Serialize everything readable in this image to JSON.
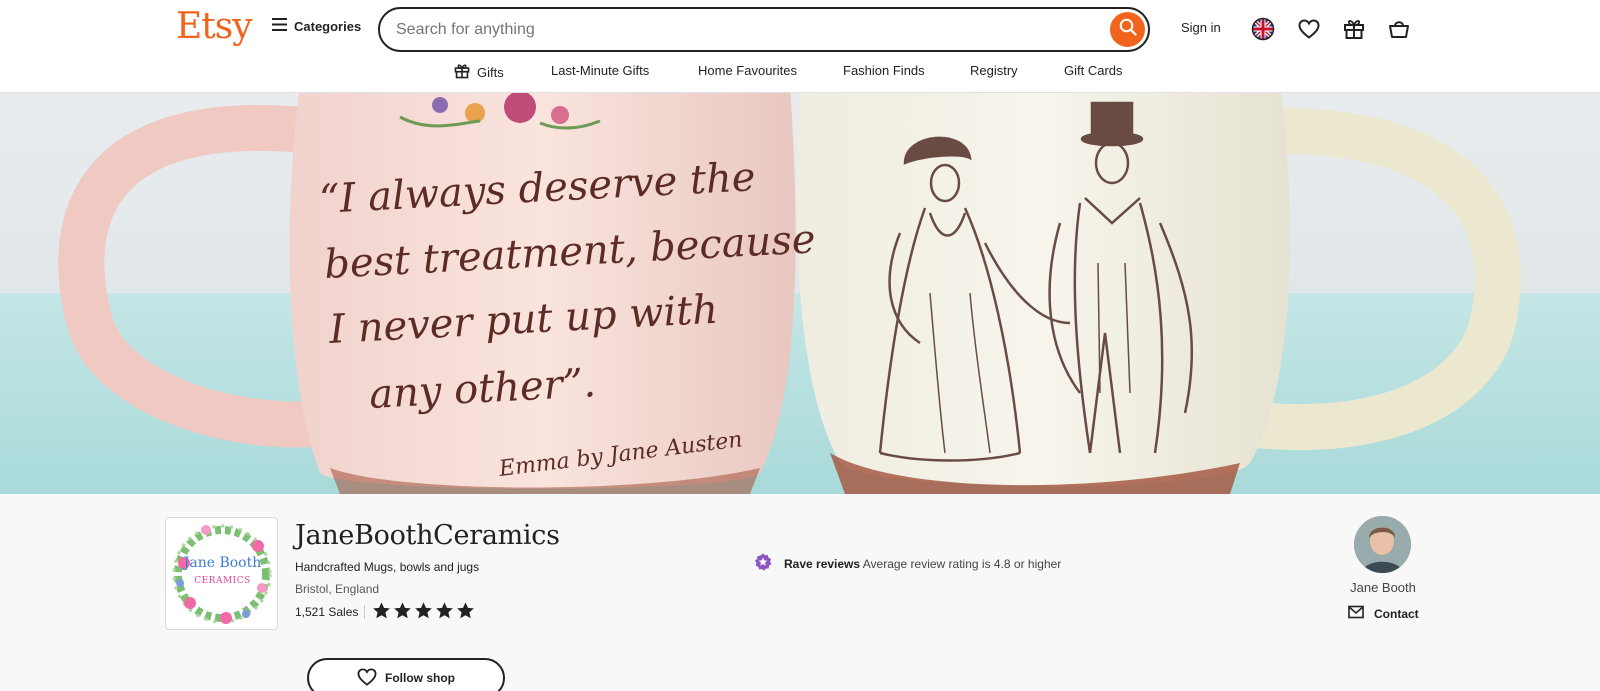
{
  "header": {
    "logo": "Etsy",
    "categories_label": "Categories",
    "search": {
      "placeholder": "Search for anything",
      "value": ""
    },
    "sign_in": "Sign in",
    "icons": [
      "menu-icon",
      "search-icon",
      "language-flag-icon",
      "heart-icon",
      "gift-icon",
      "cart-icon"
    ]
  },
  "subnav": {
    "items": [
      {
        "label": "Gifts",
        "icon": "gift-icon"
      },
      {
        "label": "Last-Minute Gifts"
      },
      {
        "label": "Home Favourites"
      },
      {
        "label": "Fashion Finds"
      },
      {
        "label": "Registry"
      },
      {
        "label": "Gift Cards"
      }
    ]
  },
  "banner": {
    "quote": "“I always deserve the best treatment, because I never put up with any other”.",
    "attribution": "Emma by Jane Austen"
  },
  "shop": {
    "logo_text": [
      "Jane Booth",
      "CERAMICS"
    ],
    "name": "JaneBoothCeramics",
    "tagline": "Handcrafted Mugs, bowls and jugs",
    "location": "Bristol, England",
    "sales": "1,521 Sales",
    "rating_stars": 5,
    "follow_label": "Follow shop",
    "rave_title": "Rave reviews",
    "rave_text": "Average review rating is 4.8 or higher",
    "owner_name": "Jane Booth",
    "contact_label": "Contact"
  },
  "colors": {
    "brand": "#f1641e",
    "rave_badge": "#8e56c2",
    "text": "#222222",
    "muted": "#595959"
  }
}
